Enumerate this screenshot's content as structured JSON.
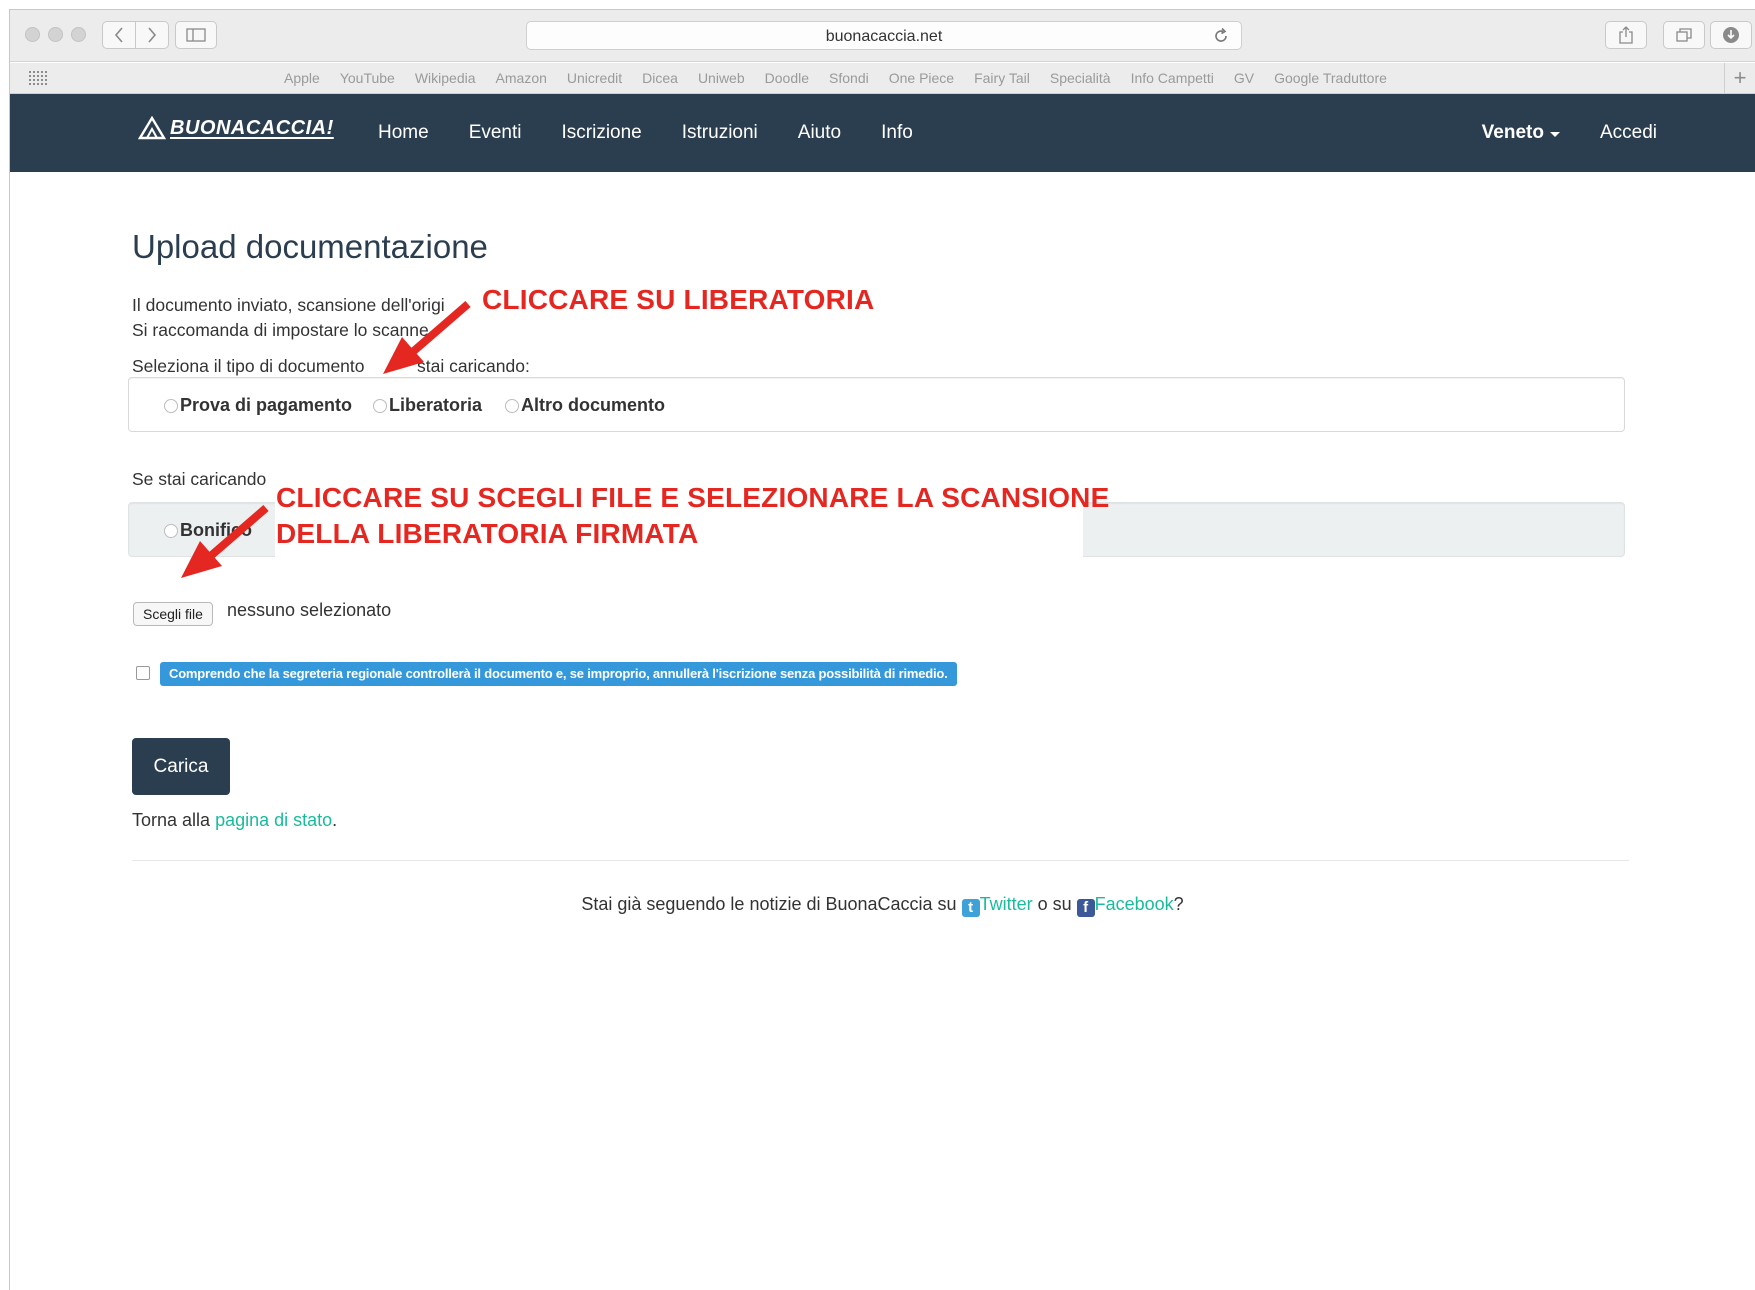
{
  "browser": {
    "url": "buonacaccia.net",
    "bookmarks": [
      "Apple",
      "YouTube",
      "Wikipedia",
      "Amazon",
      "Unicredit",
      "Dicea",
      "Uniweb",
      "Doodle",
      "Sfondi",
      "One Piece",
      "Fairy Tail",
      "Specialità",
      "Info Campetti",
      "GV",
      "Google Traduttore"
    ]
  },
  "navbar": {
    "brand": "BUONACACCIA!",
    "links": [
      "Home",
      "Eventi",
      "Iscrizione",
      "Istruzioni",
      "Aiuto",
      "Info"
    ],
    "region": "Veneto",
    "login": "Accedi"
  },
  "page": {
    "title": "Upload documentazione",
    "line1": "Il documento inviato, scansione dell'origi",
    "line2": "Si raccomanda di impostare lo scanne",
    "select_label": "Seleziona il tipo di documento",
    "select_label_tail": "stai caricando:",
    "doc_types": [
      "Prova di pagamento",
      "Liberatoria",
      "Altro documento"
    ],
    "payment_label": "Se stai caricando",
    "payment_types": [
      "Bonifico"
    ],
    "file_button": "Scegli file",
    "file_status": "nessuno selezionato",
    "consent": "Comprendo che la segreteria regionale controllerà il documento e, se improprio, annullerà l'iscrizione senza possibilità di rimedio.",
    "submit": "Carica",
    "back_prefix": "Torna alla ",
    "back_link": "pagina di stato",
    "back_suffix": "."
  },
  "footer": {
    "prefix": "Stai già seguendo le notizie di BuonaCaccia su ",
    "twitter": "Twitter",
    "middle": " o su ",
    "facebook": "Facebook",
    "suffix": "?"
  },
  "annotations": {
    "one": "CLICCARE SU LIBERATORIA",
    "two_line1": "CLICCARE SU SCEGLI FILE E SELEZIONARE LA SCANSIONE",
    "two_line2": "DELLA LIBERATORIA FIRMATA"
  },
  "colors": {
    "navbar": "#2b3e50",
    "link": "#18bc9c",
    "consent_bg": "#3498db",
    "annotation": "#e52722"
  }
}
